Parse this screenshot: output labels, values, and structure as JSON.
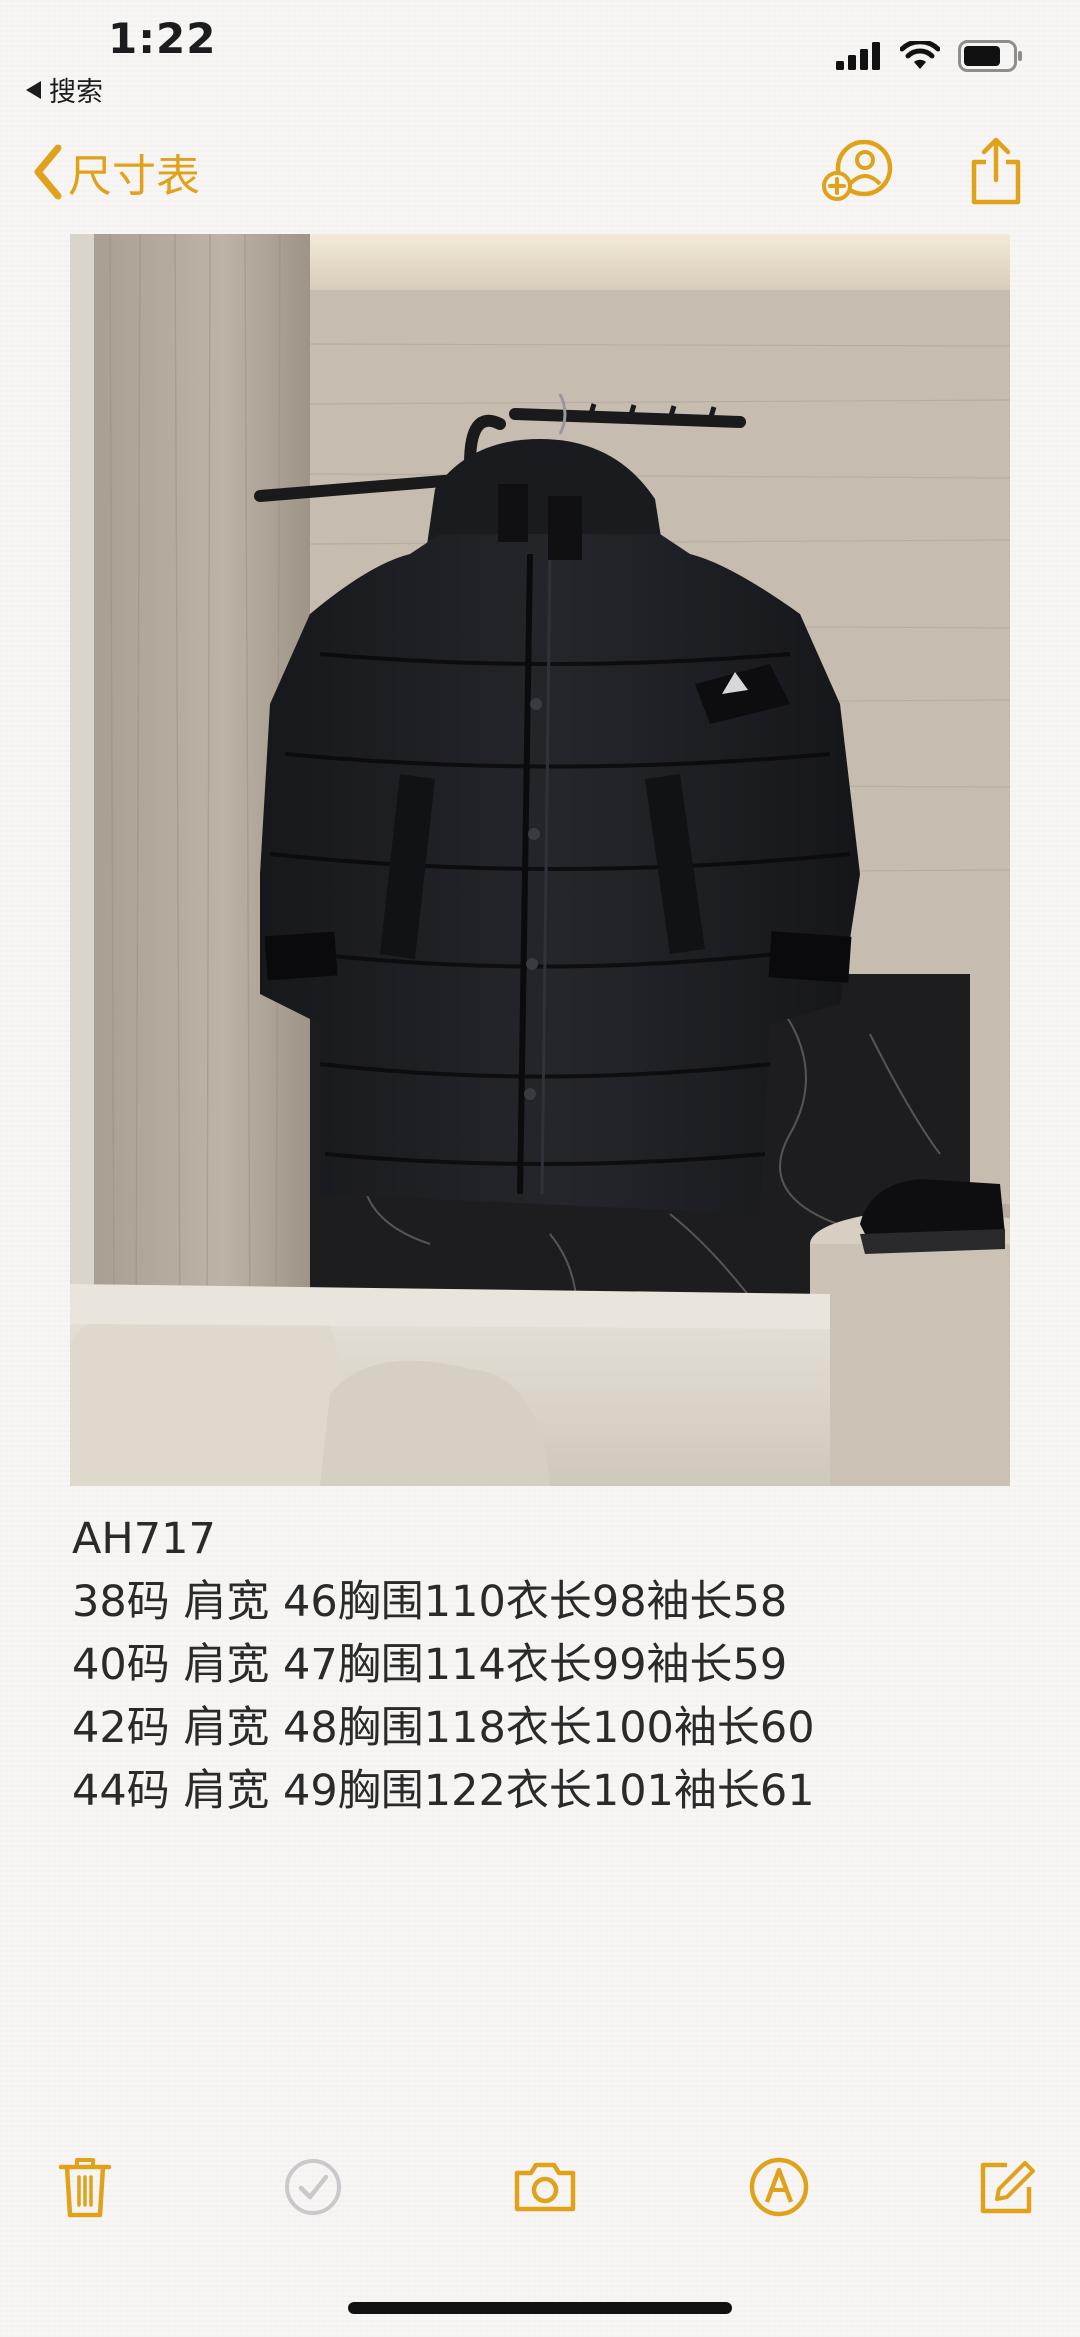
{
  "status_bar": {
    "time": "1:22",
    "back_app_label": "搜索"
  },
  "nav": {
    "back_label": "尺寸表",
    "accent_color": "#e0a21a"
  },
  "note": {
    "lines": [
      "AH717",
      "38码 肩宽 46胸围110衣长98袖长58",
      "40码 肩宽 47胸围114衣长99袖长59",
      "42码 肩宽 48胸围118衣长100袖长60",
      "44码 肩宽 49胸围122衣长101袖长61"
    ]
  },
  "toolbar": {
    "icons": [
      "trash-icon",
      "checklist-icon",
      "camera-icon",
      "markup-icon",
      "compose-icon"
    ]
  }
}
